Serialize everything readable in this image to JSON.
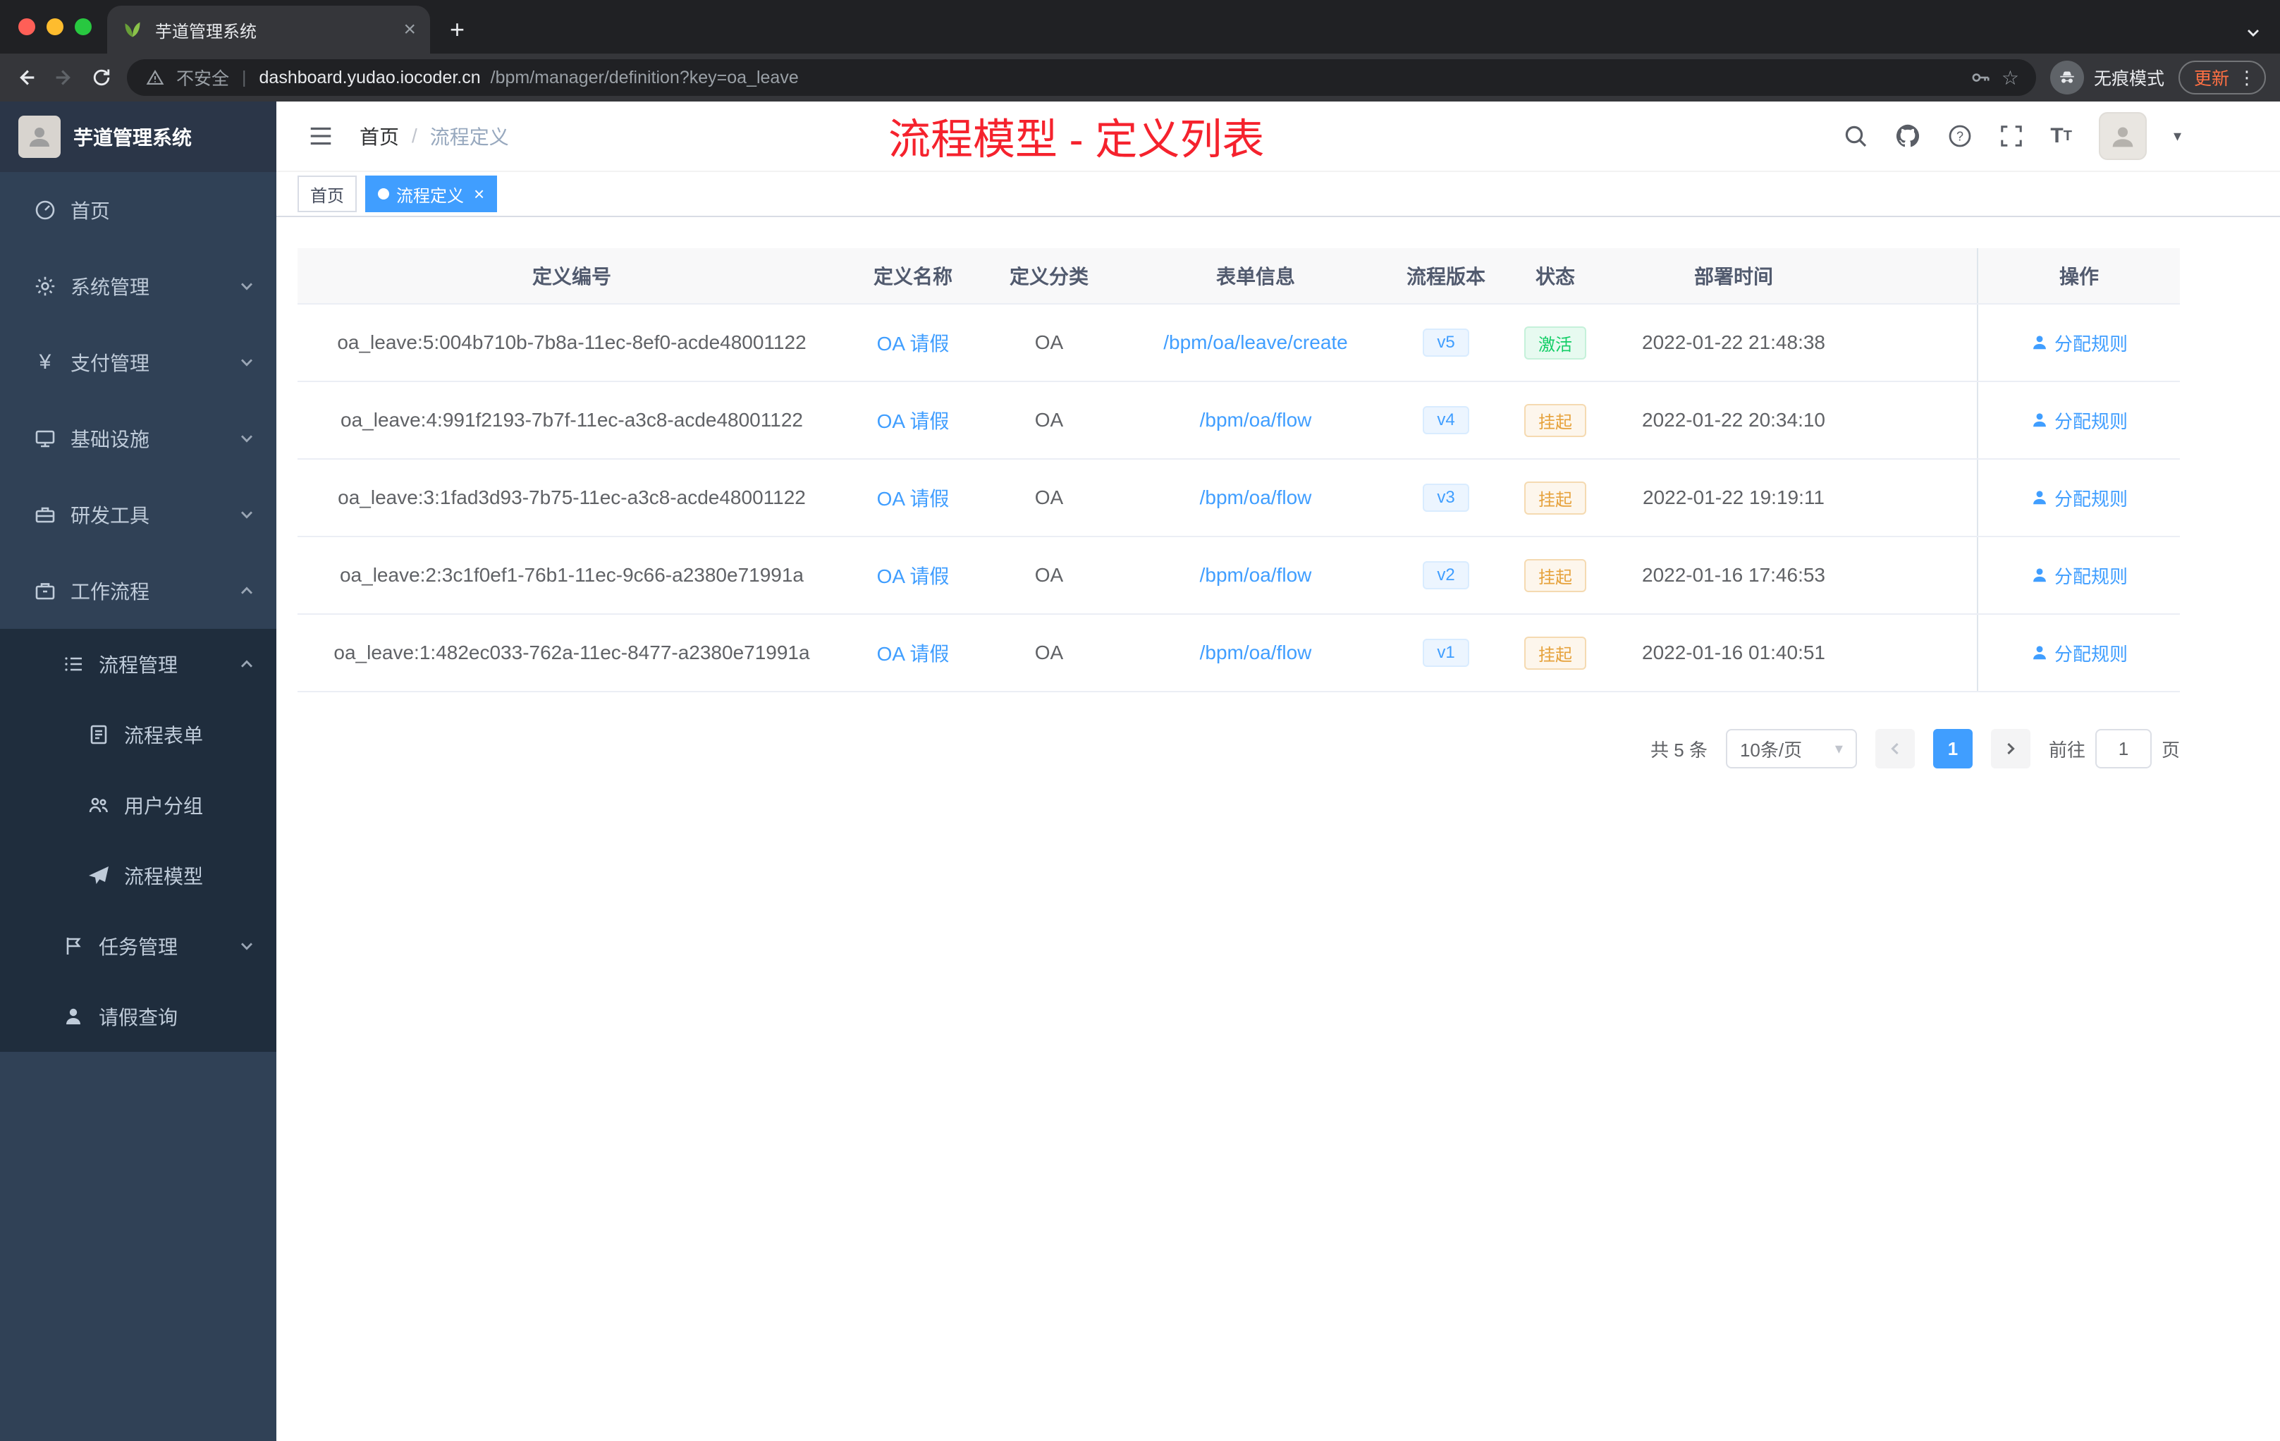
{
  "browser": {
    "tab_title": "芋道管理系统",
    "security_label": "不安全",
    "url_host": "dashboard.yudao.iocoder.cn",
    "url_path": "/bpm/manager/definition?key=oa_leave",
    "incognito_label": "无痕模式",
    "update_label": "更新"
  },
  "sidebar": {
    "logo_title": "芋道管理系统",
    "items": [
      {
        "label": "首页"
      },
      {
        "label": "系统管理"
      },
      {
        "label": "支付管理"
      },
      {
        "label": "基础设施"
      },
      {
        "label": "研发工具"
      },
      {
        "label": "工作流程"
      },
      {
        "label": "流程管理"
      },
      {
        "label": "流程表单"
      },
      {
        "label": "用户分组"
      },
      {
        "label": "流程模型"
      },
      {
        "label": "任务管理"
      },
      {
        "label": "请假查询"
      }
    ]
  },
  "header": {
    "breadcrumb": {
      "home": "首页",
      "separator": "/",
      "current": "流程定义"
    },
    "annotation": "流程模型 - 定义列表"
  },
  "tags": {
    "home": "首页",
    "active": "流程定义"
  },
  "table": {
    "columns": [
      "定义编号",
      "定义名称",
      "定义分类",
      "表单信息",
      "流程版本",
      "状态",
      "部署时间",
      "操作"
    ],
    "rows": [
      {
        "id": "oa_leave:5:004b710b-7b8a-11ec-8ef0-acde48001122",
        "name": "OA 请假",
        "category": "OA",
        "form": "/bpm/oa/leave/create",
        "version": "v5",
        "status": "激活",
        "time": "2022-01-22 21:48:38",
        "action": "分配规则"
      },
      {
        "id": "oa_leave:4:991f2193-7b7f-11ec-a3c8-acde48001122",
        "name": "OA 请假",
        "category": "OA",
        "form": "/bpm/oa/flow",
        "version": "v4",
        "status": "挂起",
        "time": "2022-01-22 20:34:10",
        "action": "分配规则"
      },
      {
        "id": "oa_leave:3:1fad3d93-7b75-11ec-a3c8-acde48001122",
        "name": "OA 请假",
        "category": "OA",
        "form": "/bpm/oa/flow",
        "version": "v3",
        "status": "挂起",
        "time": "2022-01-22 19:19:11",
        "action": "分配规则"
      },
      {
        "id": "oa_leave:2:3c1f0ef1-76b1-11ec-9c66-a2380e71991a",
        "name": "OA 请假",
        "category": "OA",
        "form": "/bpm/oa/flow",
        "version": "v2",
        "status": "挂起",
        "time": "2022-01-16 17:46:53",
        "action": "分配规则"
      },
      {
        "id": "oa_leave:1:482ec033-762a-11ec-8477-a2380e71991a",
        "name": "OA 请假",
        "category": "OA",
        "form": "/bpm/oa/flow",
        "version": "v1",
        "status": "挂起",
        "time": "2022-01-16 01:40:51",
        "action": "分配规则"
      }
    ]
  },
  "pagination": {
    "total": "共 5 条",
    "page_size": "10条/页",
    "current_page": "1",
    "goto_label": "前往",
    "goto_value": "1",
    "page_unit": "页"
  },
  "colors": {
    "primary": "#409eff",
    "success": "#13ce66",
    "warning": "#e6a23c",
    "annotation_red": "#f5222d",
    "sidebar_bg": "#304156"
  }
}
